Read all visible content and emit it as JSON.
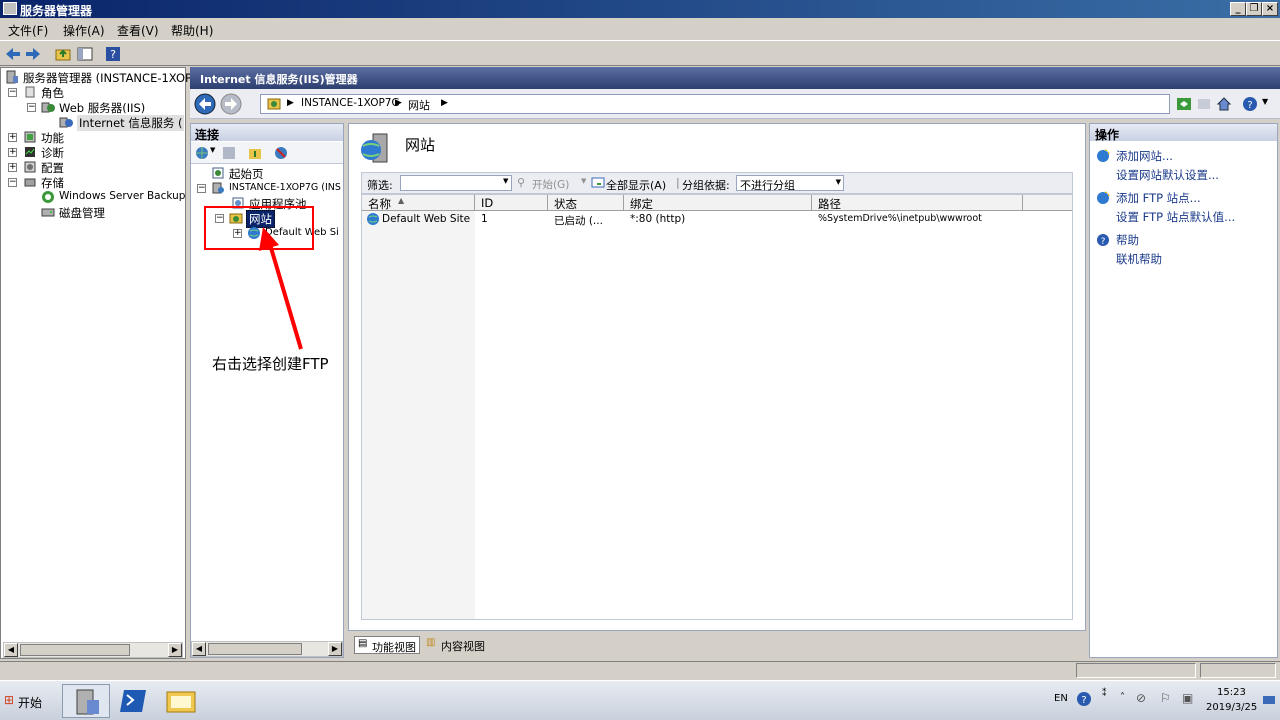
{
  "window": {
    "title": "服务器管理器"
  },
  "menu": [
    "文件(F)",
    "操作(A)",
    "查看(V)",
    "帮助(H)"
  ],
  "left_tree": {
    "root": "服务器管理器 (INSTANCE-1XOP7",
    "roles": "角色",
    "web_server": "Web 服务器(IIS)",
    "iis_manager": "Internet 信息服务 (",
    "features": "功能",
    "diagnostics": "诊断",
    "configuration": "配置",
    "storage": "存储",
    "windows_backup": "Windows Server Backup",
    "disk_mgmt": "磁盘管理"
  },
  "iis": {
    "header": "Internet 信息服务(IIS)管理器",
    "breadcrumb": [
      "INSTANCE-1XOP7G",
      "网站"
    ]
  },
  "connections": {
    "title": "连接",
    "start_page": "起始页",
    "server": "INSTANCE-1XOP7G (INS",
    "app_pools": "应用程序池",
    "sites": "网站",
    "default_site": "Default Web Si"
  },
  "center": {
    "title": "网站",
    "filter_label": "筛选:",
    "start_label": "开始(G)",
    "show_all_label": "全部显示(A)",
    "group_label": "分组依据:",
    "group_value": "不进行分组",
    "columns": [
      "名称",
      "ID",
      "状态",
      "绑定",
      "路径"
    ],
    "rows": [
      {
        "name": "Default Web Site",
        "id": "1",
        "status": "已启动 (...",
        "binding": "*:80 (http)",
        "path": "%SystemDrive%\\inetpub\\wwwroot"
      }
    ]
  },
  "view_tabs": {
    "features": "功能视图",
    "content": "内容视图"
  },
  "actions": {
    "title": "操作",
    "add_site": "添加网站...",
    "site_defaults": "设置网站默认设置...",
    "add_ftp": "添加 FTP 站点...",
    "ftp_defaults": "设置 FTP 站点默认值...",
    "help": "帮助",
    "online_help": "联机帮助"
  },
  "annotation": "右击选择创建FTP",
  "taskbar": {
    "start": "开始",
    "lang": "EN",
    "time": "15:23",
    "date": "2019/3/25"
  },
  "colors": {
    "title_bar": "#0a246a",
    "link": "#1a3a8a",
    "annotation_red": "#ff0000"
  }
}
